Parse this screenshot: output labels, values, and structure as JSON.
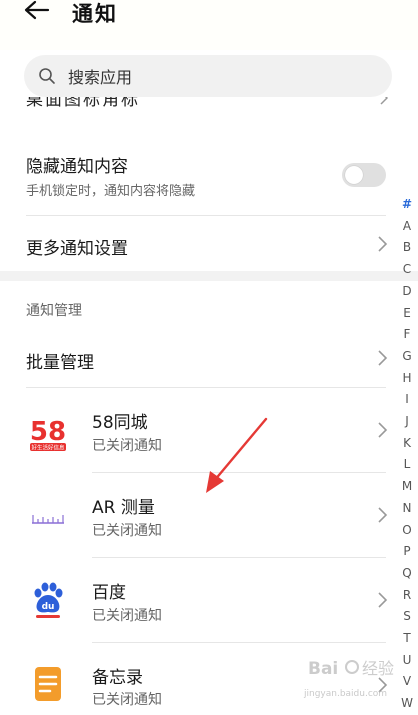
{
  "header": {
    "title": "通知"
  },
  "search": {
    "placeholder": "搜索应用"
  },
  "cut_row": {
    "label": "桌面图标角标"
  },
  "hide_content": {
    "title": "隐藏通知内容",
    "subtitle": "手机锁定时，通知内容将隐藏",
    "toggle_on": false
  },
  "more_settings": {
    "title": "更多通知设置"
  },
  "section": {
    "label": "通知管理"
  },
  "batch": {
    "title": "批量管理"
  },
  "apps": [
    {
      "name": "58同城",
      "status": "已关闭通知",
      "icon": "58-tongcheng-icon",
      "icon_text": "58",
      "icon_sub": "好生活好信息"
    },
    {
      "name": "AR 测量",
      "status": "已关闭通知",
      "icon": "ar-measure-icon"
    },
    {
      "name": "百度",
      "status": "已关闭通知",
      "icon": "baidu-icon",
      "icon_text": "du"
    },
    {
      "name": "备忘录",
      "status": "已关闭通知",
      "icon": "notepad-icon"
    }
  ],
  "index_bar": [
    "#",
    "A",
    "B",
    "C",
    "D",
    "E",
    "F",
    "G",
    "H",
    "I",
    "J",
    "K",
    "L",
    "M",
    "N",
    "O",
    "P",
    "Q",
    "R",
    "S",
    "T",
    "U",
    "V",
    "W"
  ],
  "index_active": "#",
  "watermark": {
    "line1": "Bai",
    "line2": "经验",
    "url": "jingyan.baidu.com"
  },
  "colors": {
    "accent": "#2a6ad8",
    "arrow": "#e53935",
    "tongcheng_red": "#e8312f",
    "baidu_blue": "#2d5fd9",
    "notepad_orange": "#f39c2b"
  }
}
